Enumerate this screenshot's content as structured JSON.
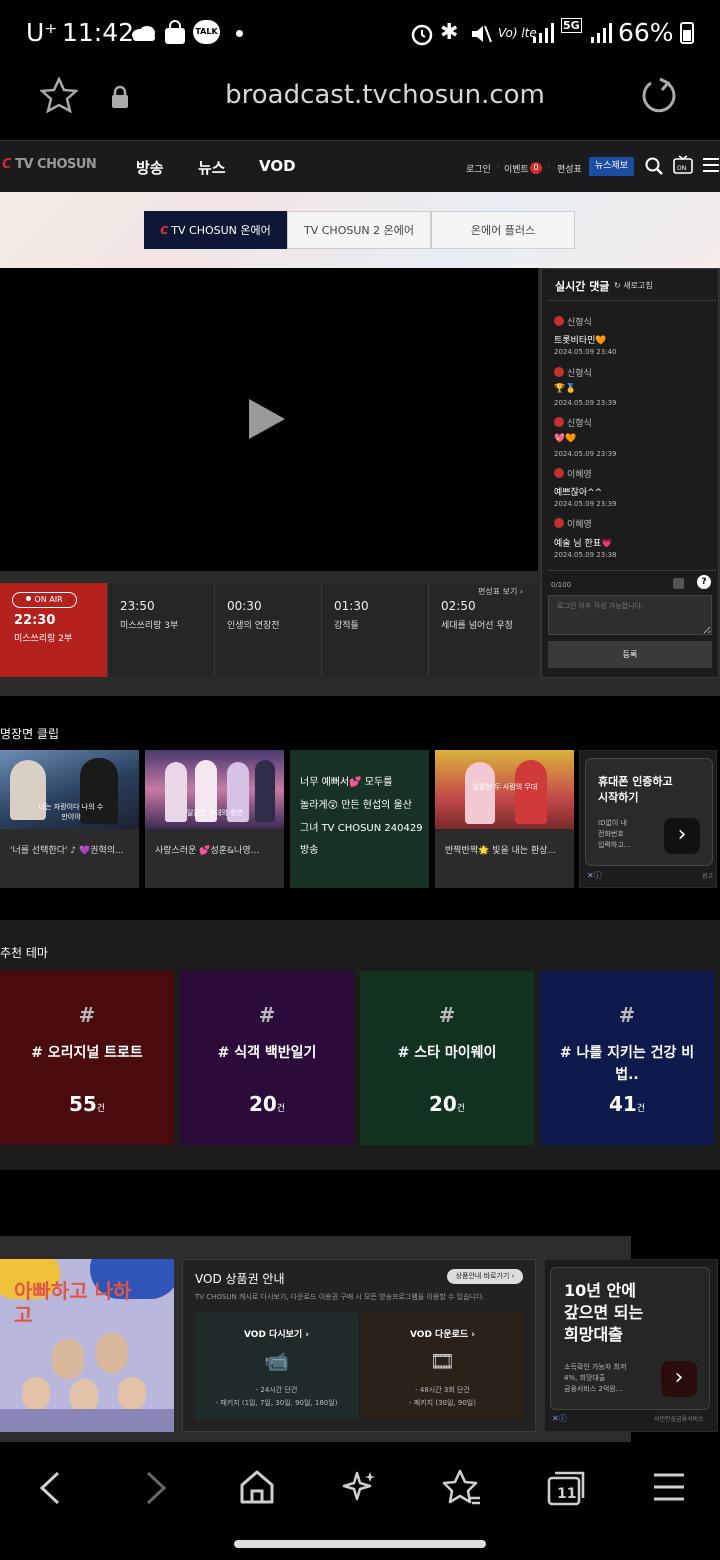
{
  "status_bar": {
    "carrier": "U⁺",
    "time": "11:42",
    "battery": "66%",
    "talk_label": "TALK",
    "volte_label": "Vo) lte",
    "net_label": "5G"
  },
  "browser": {
    "url": "broadcast.tvchosun.com"
  },
  "site": {
    "logo": "TV CHOSUN",
    "nav": [
      "방송",
      "뉴스",
      "VOD"
    ],
    "top_links": [
      "로그인",
      "이벤트",
      "편성표"
    ],
    "event_count": "0",
    "report_button": "뉴스제보"
  },
  "channel_tabs": [
    "TV CHOSUN 온에어",
    "TV CHOSUN 2 온에어",
    "온에어 플러스"
  ],
  "comments": {
    "title": "실시간 댓글",
    "refresh": "새로고침",
    "items": [
      {
        "user": "신형식",
        "text": "트롯비타민🧡",
        "date": "2024.05.09 23:40"
      },
      {
        "user": "신형식",
        "text": "🏆🥇",
        "date": "2024.05.09 23:39"
      },
      {
        "user": "신형식",
        "text": "💖🧡",
        "date": "2024.05.09 23:39"
      },
      {
        "user": "이혜영",
        "text": "예쁘잖아^^",
        "date": "2024.05.09 23:39"
      },
      {
        "user": "이혜영",
        "text": "예술 님 한표💗",
        "date": "2024.05.09 23:38"
      }
    ],
    "count": "0/100",
    "placeholder": "로그인 이후 작성 가능합니다.",
    "submit": "등록"
  },
  "schedule": {
    "onair_tag": "ON AIR",
    "now": {
      "time": "22:30",
      "program": "미스쓰리랑 2부"
    },
    "link": "편성표 보기",
    "items": [
      {
        "time": "23:50",
        "program": "미스쓰리랑 3부"
      },
      {
        "time": "00:30",
        "program": "인생의 연장전"
      },
      {
        "time": "01:30",
        "program": "강적들"
      },
      {
        "time": "02:50",
        "program": "세대를 넘어선 우정"
      }
    ]
  },
  "clips": {
    "title": "명장면 클립",
    "items": [
      {
        "caption": "'너를 선택한다' ♪ 💜권혁의..."
      },
      {
        "caption": "사랑스러운 💕성훈&나영..."
      },
      {
        "caption": "너무 예뻐서💕 모두를 놀라게😲 만든 현섭의 울산 그녀 TV CHOSUN 240429 방송"
      },
      {
        "caption": "반짝반짝🌟 빛을 내는 환상..."
      }
    ],
    "green_lines": [
      "너무 예뻐서💕 모두를",
      "놀라게😲 만든 현섭의 울산",
      "그녀 TV CHOSUN 240429",
      "방송"
    ],
    "thumb_texts": [
      "너는 자랑이다 나의 수만이야",
      "달콤한 무대의 향연",
      "발랄한 두 사람의 무대"
    ],
    "ad": {
      "title_lines": [
        "휴대폰 인증하고",
        "시작하기"
      ],
      "sub_lines": [
        "ID없이 내",
        "전화번호",
        "입력하고..."
      ],
      "label": "광고"
    }
  },
  "themes": {
    "title": "추천 테마",
    "items": [
      {
        "name": "# 오리지널 트로트",
        "count": "55",
        "unit": "건",
        "color": "#4a0b0f"
      },
      {
        "name": "# 식객 백반일기",
        "count": "20",
        "unit": "건",
        "color": "#2a0b3a"
      },
      {
        "name": "# 스타 마이웨이",
        "count": "20",
        "unit": "건",
        "color": "#123220"
      },
      {
        "name": "# 나를 지키는 건강 비법..",
        "count": "41",
        "unit": "건",
        "color": "#0e1a4c"
      }
    ]
  },
  "promo": {
    "banner_text": "아빠하고 나하고",
    "vod_title": "VOD 상품권 안내",
    "vod_link": "상품안내 바로가기",
    "vod_desc": "TV CHOSUN 캐시로 다시보기, 다운로드 이용권 구매 시 모든 방송프로그램을 이용할 수 있습니다.",
    "cards": [
      {
        "title": "VOD 다시보기",
        "line1": "- 24시간 단건",
        "line2": "- 패키지 (1일, 7일, 30일, 90일, 180일)",
        "color": "#1f2a2a"
      },
      {
        "title": "VOD 다운로드",
        "line1": "- 48시간 3회 단건",
        "line2": "- 패키지 (30일, 90일)",
        "color": "#2a2219"
      }
    ],
    "ad": {
      "title_lines": [
        "10년 안에",
        "갚으면 되는",
        "희망대출"
      ],
      "sub_lines": [
        "소득확인 가능자 최저",
        "4%, 희망대출",
        "금융서비스 2억원..."
      ],
      "brand": "서민안심금융서비스"
    }
  },
  "colors": {
    "accent_red": "#b5221d",
    "report_blue": "#1b4ea3"
  }
}
